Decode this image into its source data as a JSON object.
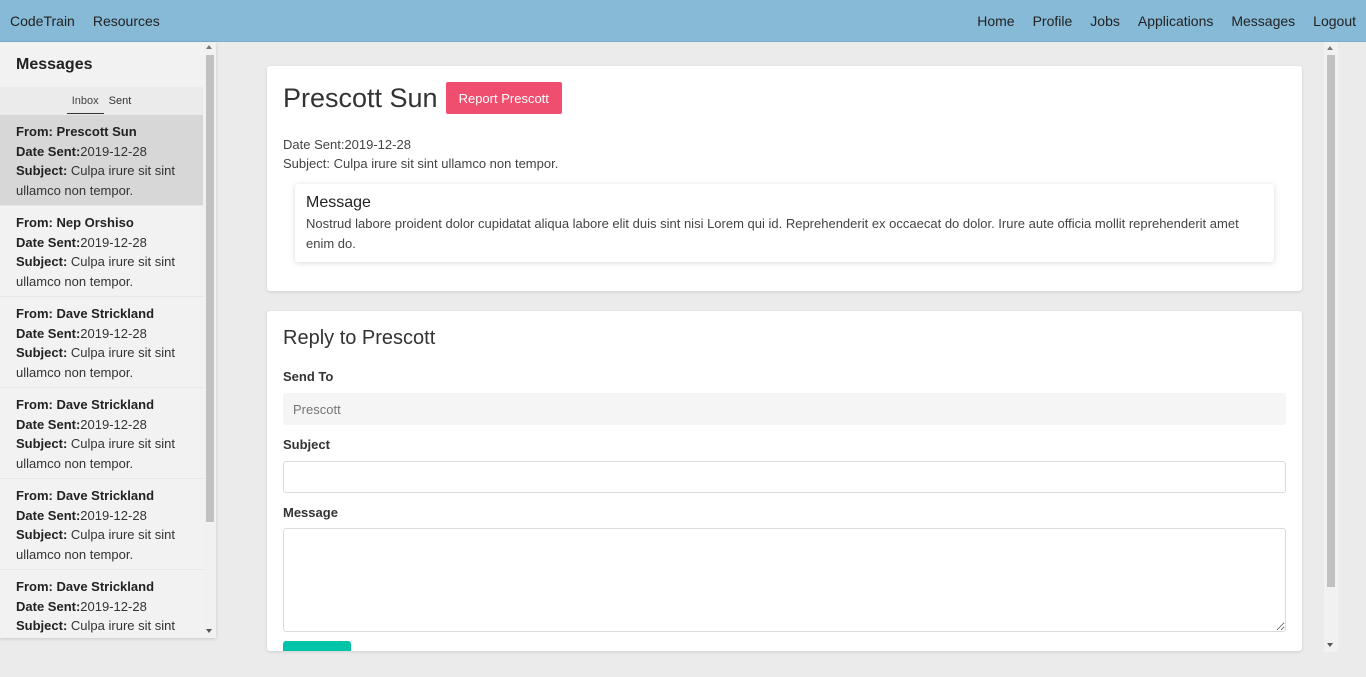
{
  "navbar": {
    "brand": "CodeTrain",
    "left_items": [
      "Resources"
    ],
    "right_items": [
      "Home",
      "Profile",
      "Jobs",
      "Applications",
      "Messages",
      "Logout"
    ]
  },
  "sidebar": {
    "title": "Messages",
    "tabs": [
      {
        "label": "Inbox",
        "active": true
      },
      {
        "label": "Sent",
        "active": false
      }
    ],
    "labels": {
      "from": "From:",
      "date_sent": "Date Sent:",
      "subject": "Subject:"
    },
    "messages": [
      {
        "from": "Prescott Sun",
        "date": "2019-12-28",
        "subject": "Culpa irure sit sint ullamco non tempor.",
        "selected": true
      },
      {
        "from": "Nep Orshiso",
        "date": "2019-12-28",
        "subject": "Culpa irure sit sint ullamco non tempor.",
        "selected": false
      },
      {
        "from": "Dave Strickland",
        "date": "2019-12-28",
        "subject": "Culpa irure sit sint ullamco non tempor.",
        "selected": false
      },
      {
        "from": "Dave Strickland",
        "date": "2019-12-28",
        "subject": "Culpa irure sit sint ullamco non tempor.",
        "selected": false
      },
      {
        "from": "Dave Strickland",
        "date": "2019-12-28",
        "subject": "Culpa irure sit sint ullamco non tempor.",
        "selected": false
      },
      {
        "from": "Dave Strickland",
        "date": "2019-12-28",
        "subject": "Culpa irure sit sint ullamco non tempor.",
        "selected": false
      }
    ]
  },
  "message_view": {
    "sender": "Prescott Sun",
    "report_label": "Report Prescott",
    "date_label": "Date Sent:",
    "date": "2019-12-28",
    "subject_label": "Subject:",
    "subject": "Culpa irure sit sint ullamco non tempor.",
    "body_title": "Message",
    "body": "Nostrud labore proident dolor cupidatat aliqua labore elit duis sint nisi Lorem qui id. Reprehenderit ex occaecat do dolor. Irure aute officia mollit reprehenderit amet enim do."
  },
  "reply": {
    "title": "Reply to Prescott",
    "send_to_label": "Send To",
    "send_to_placeholder": "Prescott",
    "subject_label": "Subject",
    "subject_value": "",
    "message_label": "Message",
    "message_value": ""
  },
  "colors": {
    "navbar": "#86bad7",
    "report_button": "#f04e6e",
    "send_button": "#00c4a7",
    "selected_item": "#d7d7d7"
  }
}
